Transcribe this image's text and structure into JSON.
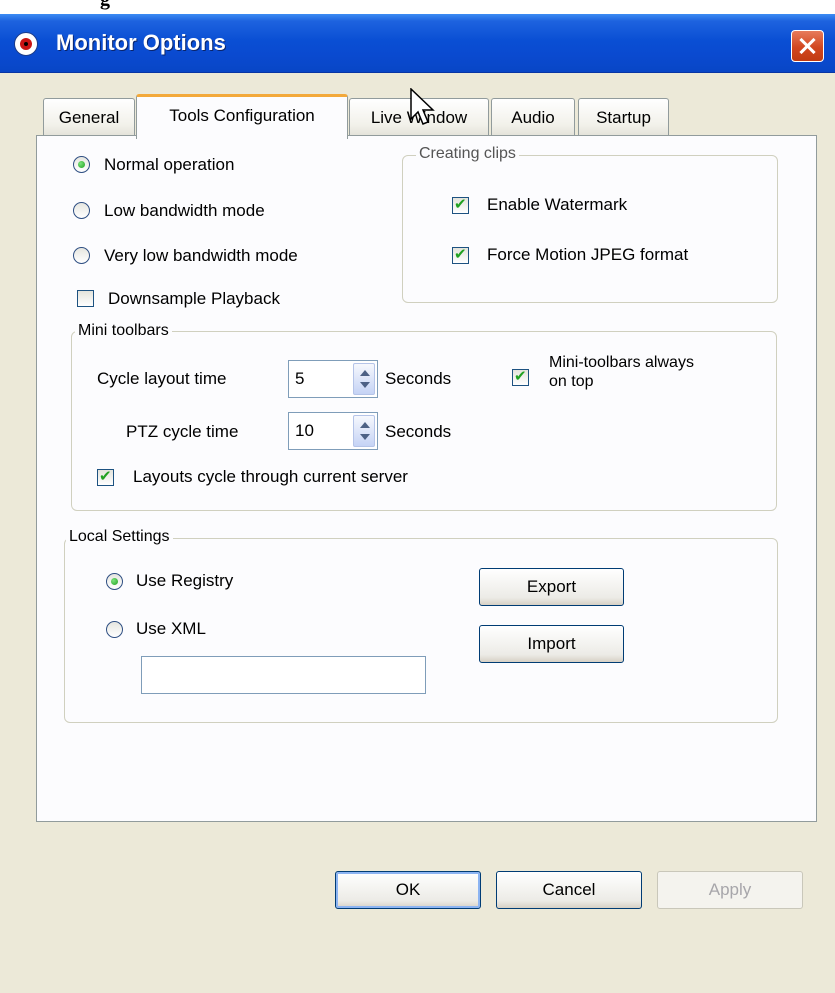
{
  "window": {
    "title": "Monitor Options",
    "partial_top_text": "g"
  },
  "tabs": [
    {
      "label": "General"
    },
    {
      "label": "Tools Configuration"
    },
    {
      "label": "Live Window"
    },
    {
      "label": "Audio"
    },
    {
      "label": "Startup"
    }
  ],
  "active_tab": "Tools Configuration",
  "operation": {
    "normal": "Normal operation",
    "low": "Low bandwidth mode",
    "very_low": "Very low bandwidth mode",
    "selected": "Normal operation"
  },
  "downsample": {
    "label": "Downsample Playback",
    "checked": false
  },
  "creating_clips": {
    "legend": "Creating clips",
    "watermark": {
      "label": "Enable Watermark",
      "checked": true
    },
    "mjpeg": {
      "label": "Force Motion JPEG format",
      "checked": true
    }
  },
  "mini_toolbars": {
    "legend": "Mini toolbars",
    "cycle_layout_label": "Cycle layout time",
    "cycle_layout_value": "5",
    "ptz_cycle_label": "PTZ cycle time",
    "ptz_cycle_value": "10",
    "seconds": "Seconds",
    "always_on_top": {
      "label_line1": "Mini-toolbars always",
      "label_line2": "on top",
      "checked": true
    },
    "layouts_cycle": {
      "label": "Layouts cycle through current server",
      "checked": true
    }
  },
  "local_settings": {
    "legend": "Local Settings",
    "use_registry": "Use Registry",
    "use_xml": "Use XML",
    "selected": "Use Registry",
    "xml_path": "",
    "export": "Export",
    "import": "Import"
  },
  "footer": {
    "ok": "OK",
    "cancel": "Cancel",
    "apply": "Apply"
  },
  "colors": {
    "titlebar": "#0a4fd4",
    "tab_accent": "#f3a93b",
    "check_green": "#21a121",
    "dialog_bg": "#ece9d8"
  }
}
